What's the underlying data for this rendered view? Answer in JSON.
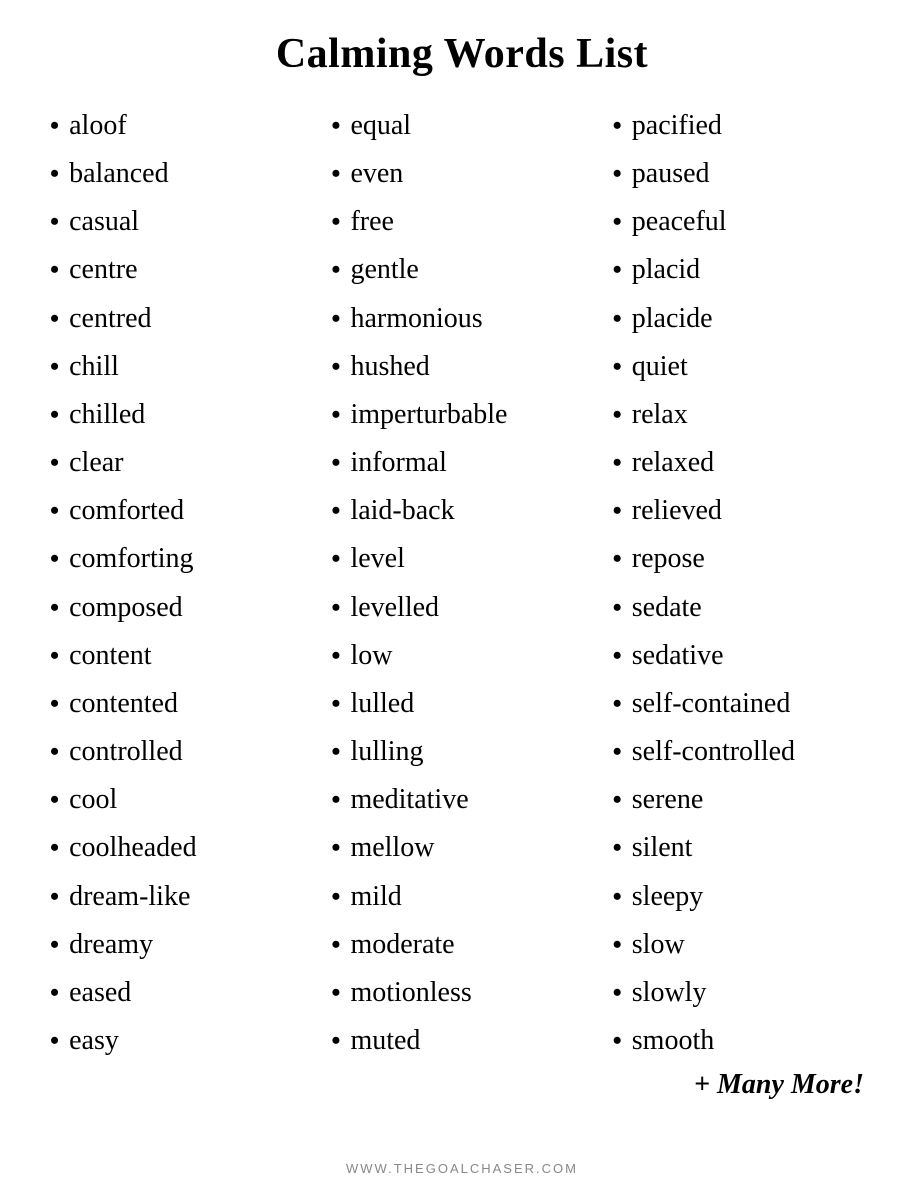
{
  "title": "Calming Words List",
  "columns": [
    {
      "id": "col1",
      "words": [
        "aloof",
        "balanced",
        "casual",
        "centre",
        "centred",
        "chill",
        "chilled",
        "clear",
        "comforted",
        "comforting",
        "composed",
        "content",
        "contented",
        "controlled",
        "cool",
        "coolheaded",
        "dream-like",
        "dreamy",
        "eased",
        "easy"
      ]
    },
    {
      "id": "col2",
      "words": [
        "equal",
        "even",
        "free",
        "gentle",
        "harmonious",
        "hushed",
        "imperturbable",
        "informal",
        "laid-back",
        "level",
        "levelled",
        "low",
        "lulled",
        "lulling",
        "meditative",
        "mellow",
        "mild",
        "moderate",
        "motionless",
        "muted"
      ]
    },
    {
      "id": "col3",
      "words": [
        "pacified",
        "paused",
        "peaceful",
        "placid",
        "placide",
        "quiet",
        "relax",
        "relaxed",
        "relieved",
        "repose",
        "sedate",
        "sedative",
        "self-contained",
        "self-controlled",
        "serene",
        "silent",
        "sleepy",
        "slow",
        "slowly",
        "smooth"
      ],
      "extra": "+ Many More!"
    }
  ],
  "footer": "WWW.THEGOALCHASER.COM"
}
